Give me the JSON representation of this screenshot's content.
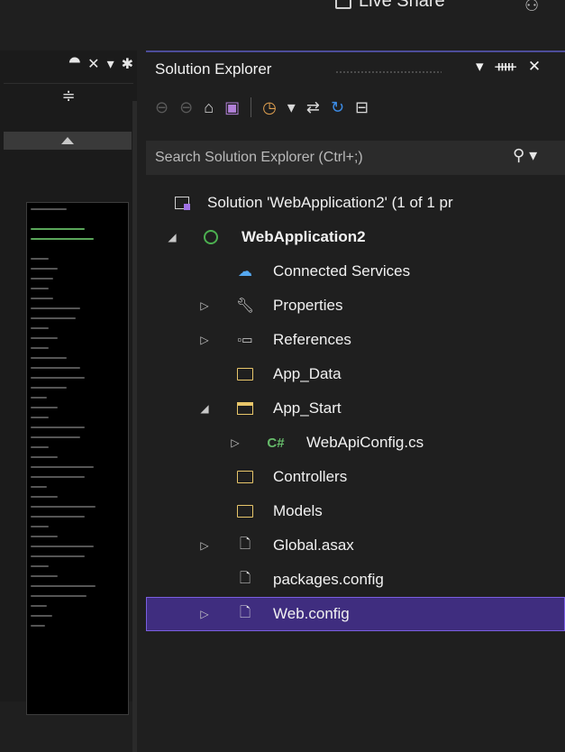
{
  "top": {
    "live_share_label": "Live Share"
  },
  "left_pane": {
    "close_label": "✕",
    "pin_label": "⯊",
    "dropdown_label": "▾",
    "settings_label": "✱",
    "split_label": "≑"
  },
  "solution_explorer": {
    "title": "Solution Explorer",
    "search_placeholder": "Search Solution Explorer (Ctrl+;)",
    "tree": [
      {
        "label": "Solution 'WebApplication2' (1 of 1 pr",
        "icon": "solution-icon",
        "expander": ""
      },
      {
        "label": "WebApplication2",
        "icon": "web-project-icon",
        "expander": "◢"
      },
      {
        "label": "Connected Services",
        "icon": "connected-services-icon",
        "expander": ""
      },
      {
        "label": "Properties",
        "icon": "wrench-icon",
        "expander": "▷"
      },
      {
        "label": "References",
        "icon": "references-icon",
        "expander": "▷"
      },
      {
        "label": "App_Data",
        "icon": "folder-icon",
        "expander": ""
      },
      {
        "label": "App_Start",
        "icon": "folder-open-icon",
        "expander": "◢"
      },
      {
        "label": "WebApiConfig.cs",
        "icon": "csharp-file-icon",
        "expander": "▷"
      },
      {
        "label": "Controllers",
        "icon": "folder-icon",
        "expander": ""
      },
      {
        "label": "Models",
        "icon": "folder-icon",
        "expander": ""
      },
      {
        "label": "Global.asax",
        "icon": "asax-file-icon",
        "expander": "▷"
      },
      {
        "label": "packages.config",
        "icon": "config-file-icon",
        "expander": ""
      },
      {
        "label": "Web.config",
        "icon": "config-file-icon",
        "expander": "▷",
        "selected": true
      }
    ]
  },
  "colors": {
    "accent": "#7a5fe0",
    "selection_bg": "#3f2d7f",
    "folder": "#e8c66a",
    "csharp": "#66bb6a"
  }
}
